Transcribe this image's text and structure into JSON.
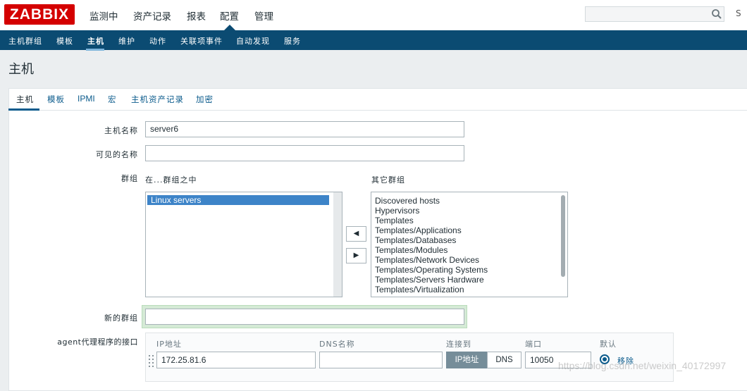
{
  "app": {
    "logo": "ZABBIX"
  },
  "top_menu": [
    "监测中",
    "资产记录",
    "报表",
    "配置",
    "管理"
  ],
  "top_extra": "S",
  "sub_menu": [
    "主机群组",
    "模板",
    "主机",
    "维护",
    "动作",
    "关联项事件",
    "自动发现",
    "服务"
  ],
  "page_title": "主机",
  "tabs": [
    "主机",
    "模板",
    "IPMI",
    "宏",
    "主机资产记录",
    "加密"
  ],
  "form": {
    "host_name_label": "主机名称",
    "host_name_value": "server6",
    "visible_name_label": "可见的名称",
    "visible_name_value": "",
    "groups_label": "群组",
    "in_groups_label": "在...群组之中",
    "other_groups_label": "其它群组",
    "in_groups": [
      "Linux servers"
    ],
    "other_groups": [
      "Discovered hosts",
      "Hypervisors",
      "Templates",
      "Templates/Applications",
      "Templates/Databases",
      "Templates/Modules",
      "Templates/Network Devices",
      "Templates/Operating Systems",
      "Templates/Servers Hardware",
      "Templates/Virtualization"
    ],
    "move_left": "◀",
    "move_right": "▶",
    "new_group_label": "新的群组",
    "new_group_value": "",
    "agent_iface_label": "agent代理程序的接口",
    "iface_headers": {
      "ip": "IP地址",
      "dns": "DNS名称",
      "connect": "连接到",
      "port": "端口",
      "default": "默认"
    },
    "iface": {
      "ip": "172.25.81.6",
      "dns": "",
      "connect_ip": "IP地址",
      "connect_dns": "DNS",
      "port": "10050",
      "remove": "移除"
    }
  },
  "watermark": "https://blog.csdn.net/weixin_40172997",
  "colors": {
    "brand": "#d40000",
    "nav": "#0b4b72",
    "link": "#0b5b8c",
    "selected": "#3d84c8"
  }
}
